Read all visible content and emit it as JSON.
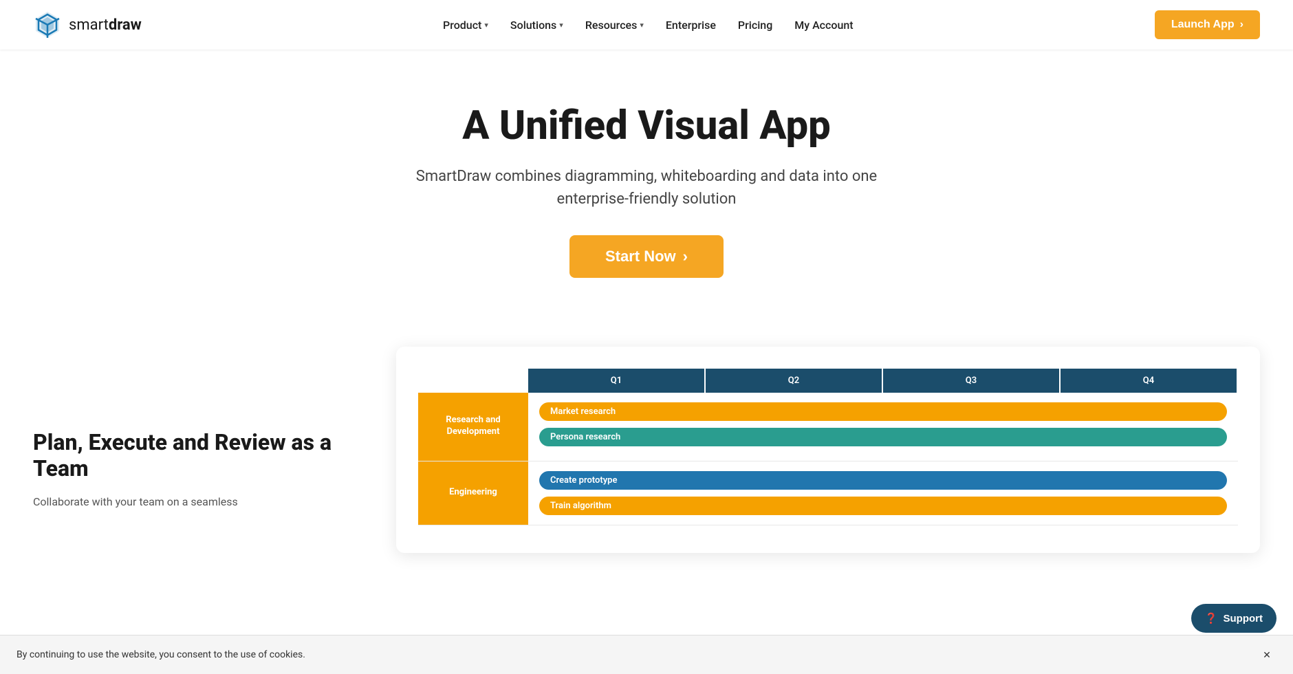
{
  "nav": {
    "logo_text_normal": "smart",
    "logo_text_bold": "draw",
    "links": [
      {
        "label": "Product",
        "has_dropdown": true
      },
      {
        "label": "Solutions",
        "has_dropdown": true
      },
      {
        "label": "Resources",
        "has_dropdown": true
      },
      {
        "label": "Enterprise",
        "has_dropdown": false
      },
      {
        "label": "Pricing",
        "has_dropdown": false
      },
      {
        "label": "My Account",
        "has_dropdown": false
      }
    ],
    "launch_btn_label": "Launch App",
    "launch_btn_arrow": "›"
  },
  "hero": {
    "heading": "A Unified Visual App",
    "subheading": "SmartDraw combines diagramming, whiteboarding and data into one enterprise-friendly solution",
    "cta_label": "Start Now",
    "cta_arrow": "›"
  },
  "lower": {
    "heading": "Plan, Execute and Review as a Team",
    "body": "Collaborate with your team on a seamless"
  },
  "gantt": {
    "quarters": [
      "Q1",
      "Q2",
      "Q3",
      "Q4"
    ],
    "rows": [
      {
        "label": "Research and Development",
        "tags": [
          {
            "text": "Market research",
            "style": "orange"
          },
          {
            "text": "Persona research",
            "style": "teal"
          }
        ]
      },
      {
        "label": "Engineering",
        "tags": [
          {
            "text": "Create prototype",
            "style": "blue"
          },
          {
            "text": "Train algorithm",
            "style": "orange"
          }
        ]
      }
    ]
  },
  "cookie": {
    "text": "By continuing to use the website, you consent to the use of cookies.",
    "close_icon": "✕"
  },
  "support": {
    "label": "Support",
    "icon": "?"
  }
}
